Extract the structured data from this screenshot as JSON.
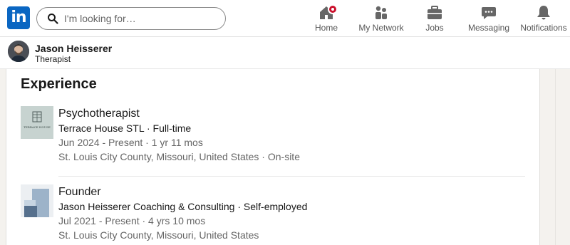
{
  "nav": {
    "search_placeholder": "I'm looking for…",
    "items": [
      {
        "label": "Home",
        "icon": "home-icon"
      },
      {
        "label": "My Network",
        "icon": "network-icon"
      },
      {
        "label": "Jobs",
        "icon": "briefcase-icon"
      },
      {
        "label": "Messaging",
        "icon": "chat-icon"
      },
      {
        "label": "Notifications",
        "icon": "bell-icon"
      }
    ],
    "brand_color": "#0a66c2",
    "badge_color": "#cb112d"
  },
  "profile": {
    "name": "Jason Heisserer",
    "headline": "Therapist"
  },
  "experience": {
    "title": "Experience",
    "items": [
      {
        "role": "Psychotherapist",
        "org": "Terrace House STL · Full-time",
        "dates": "Jun 2024 - Present · 1 yr 11 mos",
        "location": "St. Louis City County, Missouri, United States · On-site",
        "logo_text": "TERRACE HOUSE"
      },
      {
        "role": "Founder",
        "org": "Jason Heisserer Coaching & Consulting · Self-employed",
        "dates": "Jul 2021 - Present · 4 yrs 10 mos",
        "location": "St. Louis City County, Missouri, United States"
      }
    ]
  }
}
